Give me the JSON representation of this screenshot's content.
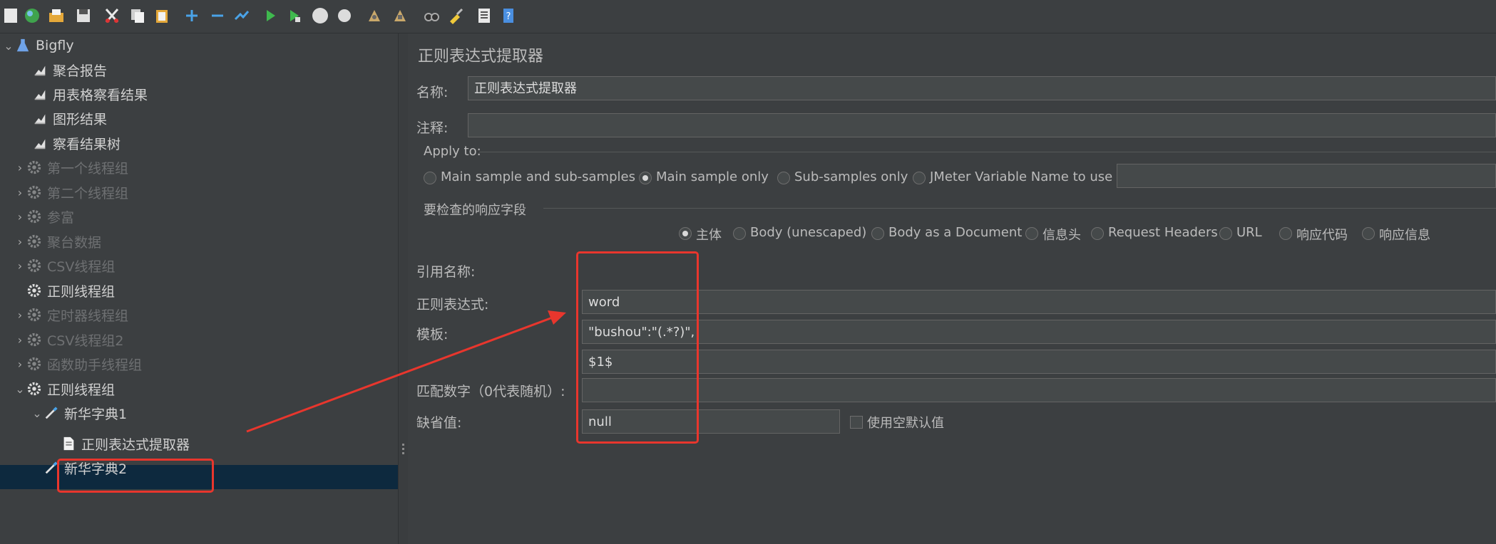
{
  "tree": {
    "items": [
      {
        "label": "Bigfly",
        "icon": "flask-icon",
        "arrow": "⌄",
        "enabled": true
      },
      {
        "label": "聚合报告",
        "icon": "graph-icon",
        "arrow": "",
        "enabled": true
      },
      {
        "label": "用表格察看结果",
        "icon": "graph-icon",
        "arrow": "",
        "enabled": true
      },
      {
        "label": "图形结果",
        "icon": "graph-icon",
        "arrow": "",
        "enabled": true
      },
      {
        "label": "察看结果树",
        "icon": "graph-icon",
        "arrow": "",
        "enabled": true
      },
      {
        "label": "第一个线程组",
        "icon": "gear-icon",
        "arrow": "›",
        "enabled": false
      },
      {
        "label": "第二个线程组",
        "icon": "gear-icon",
        "arrow": "›",
        "enabled": false
      },
      {
        "label": "参富",
        "icon": "gear-icon",
        "arrow": "›",
        "enabled": false
      },
      {
        "label": "聚台数据",
        "icon": "gear-icon",
        "arrow": "›",
        "enabled": false
      },
      {
        "label": "CSV线程组",
        "icon": "gear-icon",
        "arrow": "›",
        "enabled": false
      },
      {
        "label": "正则线程组",
        "icon": "gear-icon",
        "arrow": "",
        "enabled": true
      },
      {
        "label": "定时器线程组",
        "icon": "gear-icon",
        "arrow": "›",
        "enabled": false
      },
      {
        "label": "CSV线程组2",
        "icon": "gear-icon",
        "arrow": "›",
        "enabled": false
      },
      {
        "label": "函数助手线程组",
        "icon": "gear-icon",
        "arrow": "›",
        "enabled": false
      },
      {
        "label": "正则线程组",
        "icon": "gear-icon",
        "arrow": "⌄",
        "enabled": true
      },
      {
        "label": "新华字典1",
        "icon": "pipette-icon",
        "arrow": "⌄",
        "enabled": true
      },
      {
        "label": "正则表达式提取器",
        "icon": "document-icon",
        "arrow": "",
        "enabled": true
      },
      {
        "label": "新华字典2",
        "icon": "pipette-icon",
        "arrow": "",
        "enabled": true
      }
    ]
  },
  "panel": {
    "title": "正则表达式提取器",
    "name_label": "名称:",
    "name_value": "正则表达式提取器",
    "comment_label": "注释:",
    "comment_value": "",
    "apply_to": {
      "legend": "Apply to:",
      "options": [
        "Main sample and sub-samples",
        "Main sample only",
        "Sub-samples only",
        "JMeter Variable Name to use"
      ],
      "selected": "Main sample only",
      "variable_value": ""
    },
    "field_check": {
      "legend": "要检查的响应字段",
      "options": [
        "主体",
        "Body (unescaped)",
        "Body as a Document",
        "信息头",
        "Request Headers",
        "URL",
        "响应代码",
        "响应信息"
      ],
      "selected": "主体"
    },
    "ref_name_label": "引用名称:",
    "ref_name_value": "word",
    "regex_label": "正则表达式:",
    "regex_value": "\"bushou\":\"(.*?)\",",
    "template_label": "模板:",
    "template_value": "$1$",
    "match_no_label": "匹配数字（0代表随机）:",
    "match_no_value": "",
    "default_label": "缺省值:",
    "default_value": "null",
    "use_empty_label": "使用空默认值",
    "use_empty_checked": false
  },
  "toolbar": {
    "icons": [
      "new-icon",
      "templates-icon",
      "open-icon",
      "save-icon",
      "cut-icon",
      "copy-icon",
      "paste-icon",
      "expand-icon",
      "collapse-icon",
      "toggle-icon",
      "start-icon",
      "start-no-pause-icon",
      "stop-icon",
      "shutdown-icon",
      "remote-start-icon",
      "remote-stop-icon",
      "search-icon",
      "clear-icon",
      "function-helper-icon",
      "help-icon"
    ]
  },
  "colors": {
    "background": "#3c3f41",
    "selection": "#0d293e",
    "annotation_red": "#e8362d"
  }
}
